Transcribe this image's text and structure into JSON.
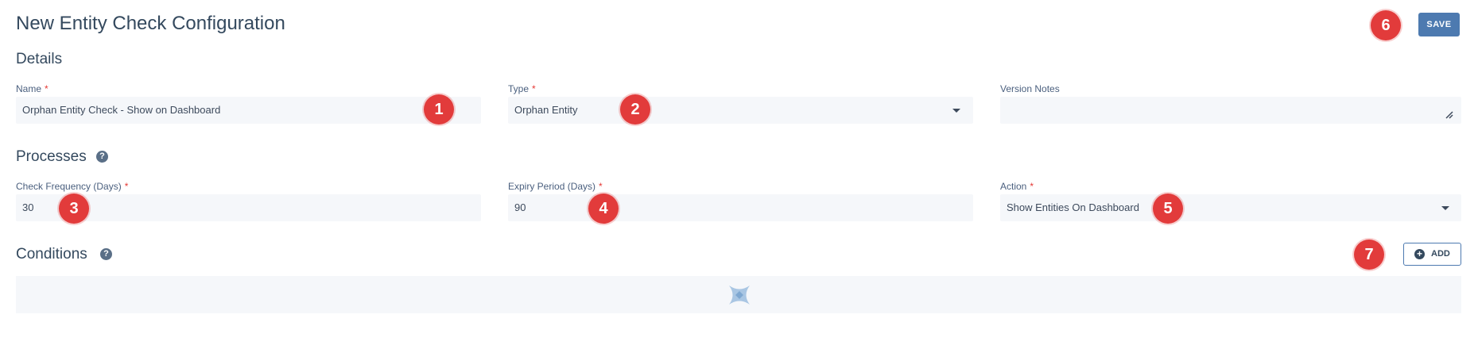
{
  "page": {
    "title": "New Entity Check Configuration"
  },
  "toolbar": {
    "save_label": "SAVE"
  },
  "details": {
    "title": "Details",
    "name": {
      "label": "Name",
      "value": "Orphan Entity Check - Show on Dashboard",
      "required": "*"
    },
    "type": {
      "label": "Type",
      "value": "Orphan Entity",
      "required": "*"
    },
    "version_notes": {
      "label": "Version Notes",
      "value": ""
    }
  },
  "processes": {
    "title": "Processes",
    "help_glyph": "?",
    "check_frequency": {
      "label": "Check Frequency (Days)",
      "value": "30",
      "required": "*"
    },
    "expiry_period": {
      "label": "Expiry Period (Days)",
      "value": "90",
      "required": "*"
    },
    "action": {
      "label": "Action",
      "value": "Show Entities On Dashboard",
      "required": "*"
    }
  },
  "conditions": {
    "title": "Conditions",
    "help_glyph": "?",
    "add_label": "ADD",
    "add_glyph": "+"
  },
  "badges": [
    "1",
    "2",
    "3",
    "4",
    "5",
    "6",
    "7"
  ],
  "colors": {
    "accent": "#4d7ab0",
    "badge": "#e23b3b",
    "required": "#e53935",
    "input_bg": "#f5f7fa",
    "text": "#34495e"
  },
  "icons": {
    "help": "question-circle-icon",
    "dropdown": "caret-down-icon",
    "resize": "resize-handle-icon",
    "add": "plus-circle-icon",
    "empty": "x-logo-icon"
  }
}
